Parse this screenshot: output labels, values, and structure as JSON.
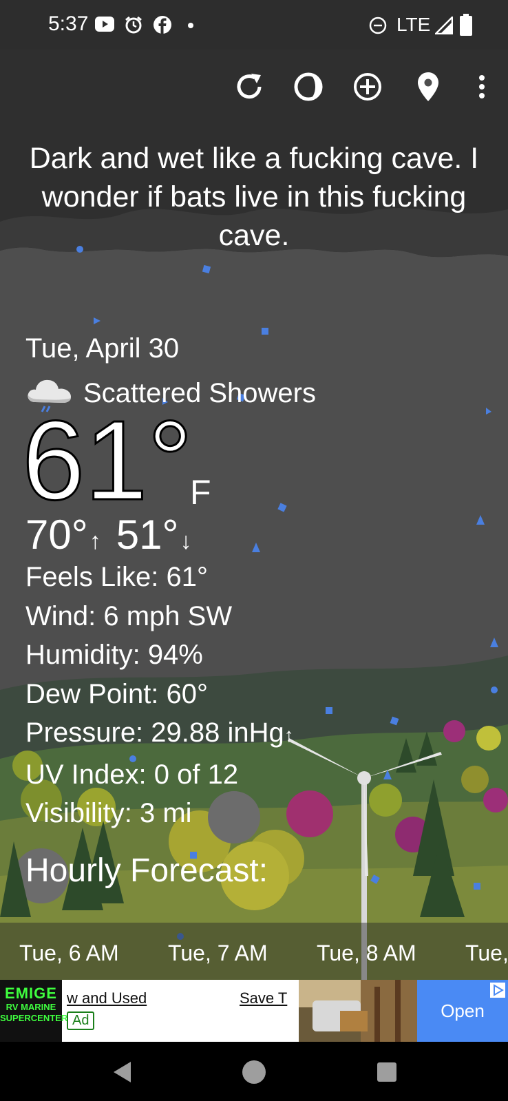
{
  "status_bar": {
    "time": "5:37",
    "network": "LTE",
    "icons": [
      "youtube-icon",
      "alarm-icon",
      "facebook-icon",
      "notification-dot-icon",
      "do-not-disturb-icon",
      "signal-icon",
      "battery-icon"
    ]
  },
  "toolbar": {
    "icons": [
      "refresh-icon",
      "theme-icon",
      "add-location-icon",
      "location-pin-icon",
      "more-options-icon"
    ]
  },
  "quote": "Dark and wet like a fucking cave. I wonder if bats live in this fucking cave.",
  "current": {
    "date": "Tue, April 30",
    "condition": "Scattered Showers",
    "condition_icon": "cloud-rain-icon",
    "temperature": "61°",
    "unit": "F",
    "high": "70°",
    "low": "51°",
    "high_arrow": "↑",
    "low_arrow": "↓"
  },
  "details": {
    "feels_like": "Feels Like:  61°",
    "wind": "Wind:  6 mph SW",
    "humidity": "Humidity:  94%",
    "dew_point": "Dew Point:  60°",
    "pressure": "Pressure:  29.88 inHg",
    "pressure_trend": "↑",
    "uv_index": "UV Index:  0 of 12",
    "visibility": "Visibility:  3 mi"
  },
  "hourly": {
    "title": "Hourly Forecast:",
    "hours": [
      "Tue, 6 AM",
      "Tue, 7 AM",
      "Tue, 8 AM",
      "Tue,"
    ]
  },
  "ad": {
    "brand": "EMIGE",
    "brand_sub1": "RV MARINE",
    "brand_sub2": "SUPERCENTER",
    "text1": "w and Used",
    "text2": "Save T",
    "badge": "Ad",
    "cta": "Open"
  },
  "colors": {
    "status_bar": "#2d2d2d",
    "background": "#4e4e4e",
    "rain_drop": "#4a7fe0",
    "ad_cta": "#4a8af4"
  }
}
